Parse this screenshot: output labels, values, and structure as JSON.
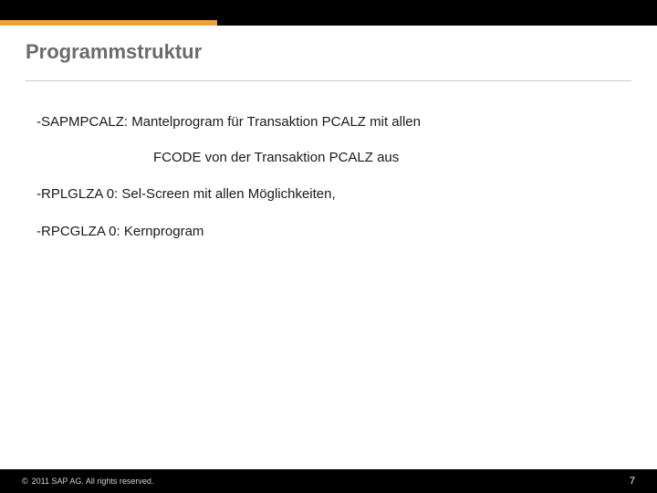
{
  "header": {
    "title": "Programmstruktur"
  },
  "items": [
    {
      "dash": "-",
      "name": "SAPMPCALZ:",
      "desc": "  Mantelprogram für Transaktion PCALZ mit allen",
      "cont": "FCODE von der Transaktion PCALZ aus"
    },
    {
      "dash": "-",
      "name": "RPLGLZA 0:",
      "desc": "  Sel-Screen mit allen Möglichkeiten,"
    },
    {
      "dash": "-",
      "name": "RPCGLZA 0:",
      "desc": " Kernprogram"
    }
  ],
  "footer": {
    "copyright_symbol": "©",
    "copyright_text": "2011 SAP AG. All rights reserved.",
    "page_number": "7"
  }
}
